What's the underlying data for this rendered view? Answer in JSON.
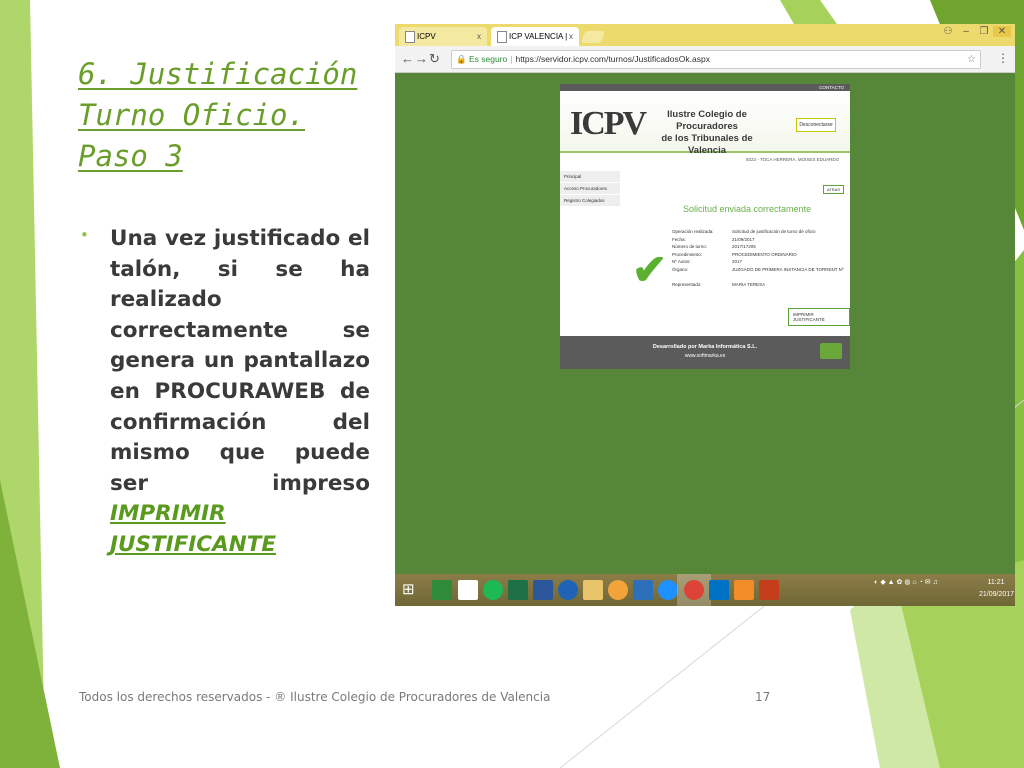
{
  "slide": {
    "title": "6. Justificación Turno Oficio. Paso 3",
    "bullet_text": "Una vez justificado el talón, si se ha realizado correctamente se genera un pantallazo en PROCURAWEB de confirmación del mismo que puede ser impreso",
    "bullet_link": "IMPRIMIR JUSTIFICANTE",
    "footer": "Todos los derechos reservados - ® Ilustre Colegio de Procuradores de Valencia",
    "page_number": "17"
  },
  "browser": {
    "tabs": [
      {
        "label": "ICPV"
      },
      {
        "label": "ICP VALENCIA | Justifica"
      }
    ],
    "secure_label": "Es seguro",
    "url": "https://servidor.icpv.com/turnos/JustificadosOk.aspx"
  },
  "site": {
    "contacto": "CONTACTO",
    "logo_abbr": "ICPV",
    "name_line1": "Ilustre Colegio de Procuradores",
    "name_line2": "de los Tribunales de Valencia",
    "logout_label": "Desconectarse",
    "user_line": "5023 - TOCA HERRERA, MOISES EDUARDO",
    "menu": [
      "Principal",
      "Acceso Procuradores",
      "Registro Colegiados"
    ],
    "back_label": "ATRAS",
    "success_title": "Solicitud enviada correctamente",
    "details": [
      {
        "label": "Operación realizada:",
        "value": "Solicitud de justificación de turno de oficio"
      },
      {
        "label": "Fecha:",
        "value": "21/09/2017"
      },
      {
        "label": "Número de turno:",
        "value": "2017/17205"
      },
      {
        "label": "Procedimiento:",
        "value": "PROCEDIMIENTO ORDINARIO"
      },
      {
        "label": "Nº Autos:",
        "value": "2017"
      },
      {
        "label": "Órgano:",
        "value": "JUZGADO DE PRIMERA INSTANCIA DE TORRENT Nº"
      },
      {
        "label": "",
        "value": ""
      },
      {
        "label": "Representado:",
        "value": "MARIA TERESA"
      }
    ],
    "print_label": "IMPRIMIR JUSTIFICANTE",
    "footer_line1": "Desarrollado por Marka Informática S.L.",
    "footer_line2": "www.softmarka.es"
  },
  "taskbar": {
    "time": "11:21",
    "date": "21/09/2017"
  },
  "colors": {
    "accent": "#6a9e2a",
    "screenshot_bg": "#568637"
  }
}
